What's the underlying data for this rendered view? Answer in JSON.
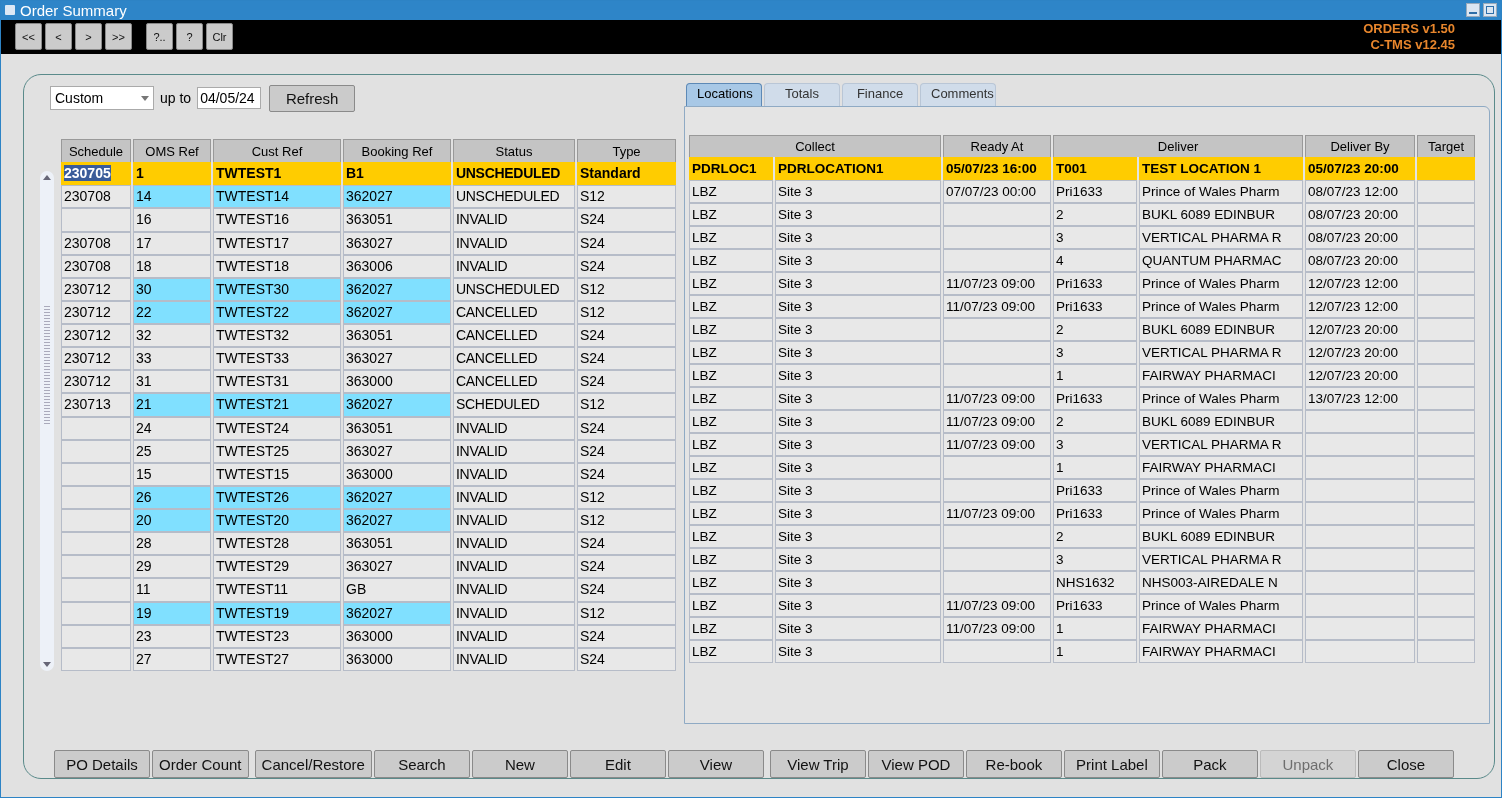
{
  "window": {
    "title": "Order Summary"
  },
  "toolbar": {
    "buttons": [
      "<<",
      "<",
      ">",
      ">>",
      "?..",
      "?",
      "Clr"
    ],
    "versions": [
      "ORDERS v1.50",
      "C-TMS v12.45"
    ]
  },
  "filter": {
    "period": "Custom",
    "up_to_label": "up to",
    "date": "04/05/24",
    "refresh": "Refresh"
  },
  "orders": {
    "columns": [
      "Schedule",
      "OMS Ref",
      "Cust Ref",
      "Booking Ref",
      "Status",
      "Type"
    ],
    "rows": [
      {
        "cells": [
          "230705",
          "1",
          "TWTEST1",
          "B1",
          "UNSCHEDULED",
          "Standard"
        ],
        "selected": true,
        "flagged": false
      },
      {
        "cells": [
          "230708",
          "14",
          "TWTEST14",
          "362027",
          "UNSCHEDULED",
          "S12"
        ],
        "selected": false,
        "flagged": true
      },
      {
        "cells": [
          null,
          "16",
          "TWTEST16",
          "363051",
          "INVALID",
          "S24"
        ],
        "selected": false,
        "flagged": false
      },
      {
        "cells": [
          "230708",
          "17",
          "TWTEST17",
          "363027",
          "INVALID",
          "S24"
        ],
        "selected": false,
        "flagged": false
      },
      {
        "cells": [
          "230708",
          "18",
          "TWTEST18",
          "363006",
          "INVALID",
          "S24"
        ],
        "selected": false,
        "flagged": false
      },
      {
        "cells": [
          "230712",
          "30",
          "TWTEST30",
          "362027",
          "UNSCHEDULED",
          "S12"
        ],
        "selected": false,
        "flagged": true
      },
      {
        "cells": [
          "230712",
          "22",
          "TWTEST22",
          "362027",
          "CANCELLED",
          "S12"
        ],
        "selected": false,
        "flagged": true
      },
      {
        "cells": [
          "230712",
          "32",
          "TWTEST32",
          "363051",
          "CANCELLED",
          "S24"
        ],
        "selected": false,
        "flagged": false
      },
      {
        "cells": [
          "230712",
          "33",
          "TWTEST33",
          "363027",
          "CANCELLED",
          "S24"
        ],
        "selected": false,
        "flagged": false
      },
      {
        "cells": [
          "230712",
          "31",
          "TWTEST31",
          "363000",
          "CANCELLED",
          "S24"
        ],
        "selected": false,
        "flagged": false
      },
      {
        "cells": [
          "230713",
          "21",
          "TWTEST21",
          "362027",
          "SCHEDULED",
          "S12"
        ],
        "selected": false,
        "flagged": true
      },
      {
        "cells": [
          null,
          "24",
          "TWTEST24",
          "363051",
          "INVALID",
          "S24"
        ],
        "selected": false,
        "flagged": false
      },
      {
        "cells": [
          null,
          "25",
          "TWTEST25",
          "363027",
          "INVALID",
          "S24"
        ],
        "selected": false,
        "flagged": false
      },
      {
        "cells": [
          null,
          "15",
          "TWTEST15",
          "363000",
          "INVALID",
          "S24"
        ],
        "selected": false,
        "flagged": false
      },
      {
        "cells": [
          null,
          "26",
          "TWTEST26",
          "362027",
          "INVALID",
          "S12"
        ],
        "selected": false,
        "flagged": true
      },
      {
        "cells": [
          null,
          "20",
          "TWTEST20",
          "362027",
          "INVALID",
          "S12"
        ],
        "selected": false,
        "flagged": true
      },
      {
        "cells": [
          null,
          "28",
          "TWTEST28",
          "363051",
          "INVALID",
          "S24"
        ],
        "selected": false,
        "flagged": false
      },
      {
        "cells": [
          null,
          "29",
          "TWTEST29",
          "363027",
          "INVALID",
          "S24"
        ],
        "selected": false,
        "flagged": false
      },
      {
        "cells": [
          null,
          "11",
          "TWTEST11",
          "GB",
          "INVALID",
          "S24"
        ],
        "selected": false,
        "flagged": false
      },
      {
        "cells": [
          null,
          "19",
          "TWTEST19",
          "362027",
          "INVALID",
          "S12"
        ],
        "selected": false,
        "flagged": true
      },
      {
        "cells": [
          null,
          "23",
          "TWTEST23",
          "363000",
          "INVALID",
          "S24"
        ],
        "selected": false,
        "flagged": false
      },
      {
        "cells": [
          null,
          "27",
          "TWTEST27",
          "363000",
          "INVALID",
          "S24"
        ],
        "selected": false,
        "flagged": false
      }
    ]
  },
  "tabs": [
    {
      "label": "Locations",
      "selected": true
    },
    {
      "label": "Totals",
      "selected": false
    },
    {
      "label": "Finance",
      "selected": false
    },
    {
      "label": "Comments",
      "selected": false
    }
  ],
  "locations": {
    "columns": [
      {
        "label": "Collect",
        "colspan": 2
      },
      {
        "label": "Ready At"
      },
      {
        "label": "Deliver",
        "colspan": 2
      },
      {
        "label": "Deliver By"
      },
      {
        "label": "Target"
      }
    ],
    "rows": [
      {
        "cells": [
          "PDRLOC1",
          "PDRLOCATION1",
          "05/07/23 16:00",
          "T001",
          "TEST LOCATION 1",
          "05/07/23 20:00",
          null
        ],
        "selected": true
      },
      {
        "cells": [
          "LBZ",
          "Site 3",
          "07/07/23 00:00",
          "Pri1633",
          "Prince of Wales Pharm",
          "08/07/23 12:00",
          null
        ],
        "selected": false
      },
      {
        "cells": [
          "LBZ",
          "Site 3",
          null,
          "2",
          "BUKL 6089 EDINBUR",
          "08/07/23 20:00",
          null
        ],
        "selected": false
      },
      {
        "cells": [
          "LBZ",
          "Site 3",
          null,
          "3",
          "VERTICAL PHARMA R",
          "08/07/23 20:00",
          null
        ],
        "selected": false
      },
      {
        "cells": [
          "LBZ",
          "Site 3",
          null,
          "4",
          "QUANTUM PHARMAC",
          "08/07/23 20:00",
          null
        ],
        "selected": false
      },
      {
        "cells": [
          "LBZ",
          "Site 3",
          "11/07/23 09:00",
          "Pri1633",
          "Prince of Wales Pharm",
          "12/07/23 12:00",
          null
        ],
        "selected": false
      },
      {
        "cells": [
          "LBZ",
          "Site 3",
          "11/07/23 09:00",
          "Pri1633",
          "Prince of Wales Pharm",
          "12/07/23 12:00",
          null
        ],
        "selected": false
      },
      {
        "cells": [
          "LBZ",
          "Site 3",
          null,
          "2",
          "BUKL 6089 EDINBUR",
          "12/07/23 20:00",
          null
        ],
        "selected": false
      },
      {
        "cells": [
          "LBZ",
          "Site 3",
          null,
          "3",
          "VERTICAL PHARMA R",
          "12/07/23 20:00",
          null
        ],
        "selected": false
      },
      {
        "cells": [
          "LBZ",
          "Site 3",
          null,
          "1",
          "FAIRWAY PHARMACI",
          "12/07/23 20:00",
          null
        ],
        "selected": false
      },
      {
        "cells": [
          "LBZ",
          "Site 3",
          "11/07/23 09:00",
          "Pri1633",
          "Prince of Wales Pharm",
          "13/07/23 12:00",
          null
        ],
        "selected": false
      },
      {
        "cells": [
          "LBZ",
          "Site 3",
          "11/07/23 09:00",
          "2",
          "BUKL 6089 EDINBUR",
          null,
          null
        ],
        "selected": false
      },
      {
        "cells": [
          "LBZ",
          "Site 3",
          "11/07/23 09:00",
          "3",
          "VERTICAL PHARMA R",
          null,
          null
        ],
        "selected": false
      },
      {
        "cells": [
          "LBZ",
          "Site 3",
          null,
          "1",
          "FAIRWAY PHARMACI",
          null,
          null
        ],
        "selected": false
      },
      {
        "cells": [
          "LBZ",
          "Site 3",
          null,
          "Pri1633",
          "Prince of Wales Pharm",
          null,
          null
        ],
        "selected": false
      },
      {
        "cells": [
          "LBZ",
          "Site 3",
          "11/07/23 09:00",
          "Pri1633",
          "Prince of Wales Pharm",
          null,
          null
        ],
        "selected": false
      },
      {
        "cells": [
          "LBZ",
          "Site 3",
          null,
          "2",
          "BUKL 6089 EDINBUR",
          null,
          null
        ],
        "selected": false
      },
      {
        "cells": [
          "LBZ",
          "Site 3",
          null,
          "3",
          "VERTICAL PHARMA R",
          null,
          null
        ],
        "selected": false
      },
      {
        "cells": [
          "LBZ",
          "Site 3",
          null,
          "NHS1632",
          "NHS003-AIREDALE N",
          null,
          null
        ],
        "selected": false
      },
      {
        "cells": [
          "LBZ",
          "Site 3",
          "11/07/23 09:00",
          "Pri1633",
          "Prince of Wales Pharm",
          null,
          null
        ],
        "selected": false
      },
      {
        "cells": [
          "LBZ",
          "Site 3",
          "11/07/23 09:00",
          "1",
          "FAIRWAY PHARMACI",
          null,
          null
        ],
        "selected": false
      },
      {
        "cells": [
          "LBZ",
          "Site 3",
          null,
          "1",
          "FAIRWAY PHARMACI",
          null,
          null
        ],
        "selected": false
      }
    ]
  },
  "actions": [
    {
      "label": "PO Details",
      "disabled": false
    },
    {
      "label": "Order Count",
      "disabled": false
    },
    {
      "label": "Cancel/Restore",
      "disabled": false
    },
    {
      "label": "Search",
      "disabled": false
    },
    {
      "label": "New",
      "disabled": false
    },
    {
      "label": "Edit",
      "disabled": false
    },
    {
      "label": "View",
      "disabled": false
    },
    {
      "label": "View Trip",
      "disabled": false
    },
    {
      "label": "View POD",
      "disabled": false
    },
    {
      "label": "Re-book",
      "disabled": false
    },
    {
      "label": "Print Label",
      "disabled": false
    },
    {
      "label": "Pack",
      "disabled": false
    },
    {
      "label": "Unpack",
      "disabled": true
    },
    {
      "label": "Close",
      "disabled": false
    }
  ]
}
